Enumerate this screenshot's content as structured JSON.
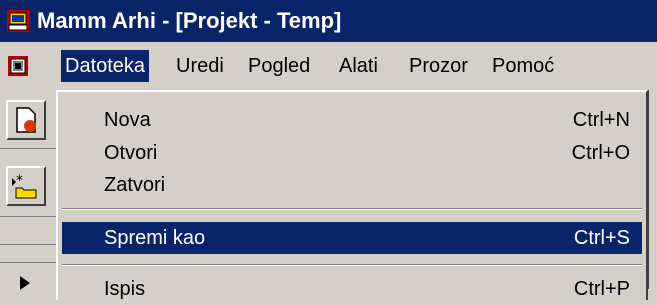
{
  "window": {
    "title": "Mamm Arhi - [Projekt - Temp]",
    "app_icon": "app-computer-icon",
    "title_bg": "#0a246a"
  },
  "menubar": {
    "system_icon": "document-system-icon",
    "items": [
      {
        "label": "Datoteka",
        "active": true
      },
      {
        "label": "Uredi"
      },
      {
        "label": "Pogled"
      },
      {
        "label": "Alati"
      },
      {
        "label": "Prozor"
      },
      {
        "label": "Pomoć"
      }
    ]
  },
  "file_menu": {
    "items": [
      {
        "label": "Nova",
        "shortcut": "Ctrl+N"
      },
      {
        "label": "Otvori",
        "shortcut": "Ctrl+O"
      },
      {
        "label": "Zatvori",
        "shortcut": ""
      },
      {
        "label": "Spremi kao",
        "shortcut": "Ctrl+S",
        "selected": true
      },
      {
        "label": "Ispis",
        "shortcut": "Ctrl+P"
      }
    ]
  },
  "toolbar": {
    "icons": [
      "new-document-icon",
      "add-folder-icon",
      "arrow-right-icon"
    ]
  },
  "colors": {
    "selection": "#0a246a",
    "face": "#d4d0c8"
  }
}
